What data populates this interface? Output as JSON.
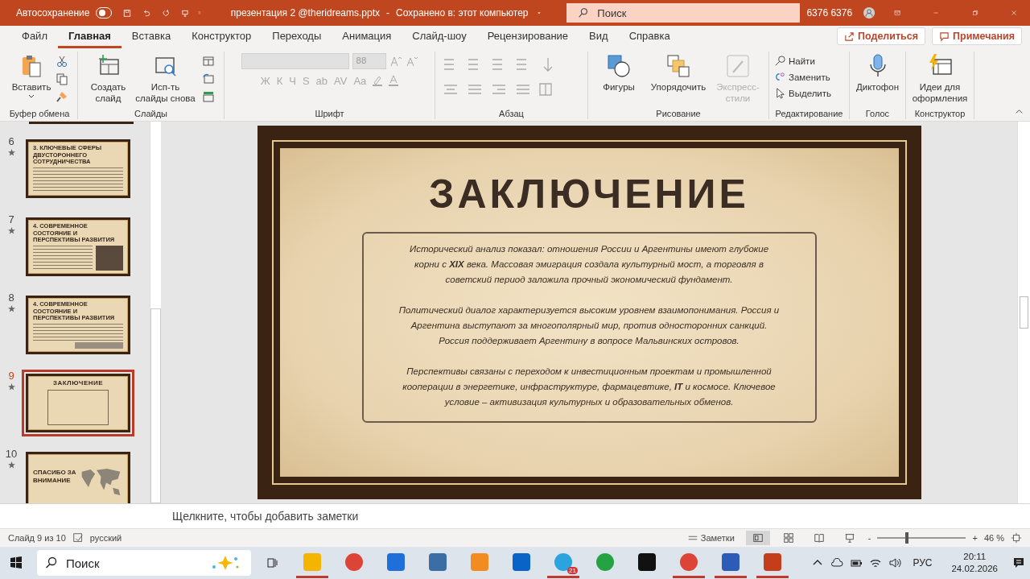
{
  "title_bar": {
    "autosave_label": "Автосохранение",
    "autosave_on": false,
    "document": "презентация 2 @theridreams.pptx",
    "separator": "-",
    "save_status": "Сохранено в: этот компьютер",
    "search_placeholder": "Поиск",
    "user": "6376 6376"
  },
  "tabs": [
    {
      "label": "Файл",
      "selected": false
    },
    {
      "label": "Главная",
      "selected": true
    },
    {
      "label": "Вставка",
      "selected": false
    },
    {
      "label": "Конструктор",
      "selected": false
    },
    {
      "label": "Переходы",
      "selected": false
    },
    {
      "label": "Анимация",
      "selected": false
    },
    {
      "label": "Слайд-шоу",
      "selected": false
    },
    {
      "label": "Рецензирование",
      "selected": false
    },
    {
      "label": "Вид",
      "selected": false
    },
    {
      "label": "Справка",
      "selected": false
    }
  ],
  "share_button": "Поделиться",
  "comments_button": "Примечания",
  "ribbon": {
    "clipboard": {
      "name": "Буфер обмена",
      "paste": "Вставить"
    },
    "slides": {
      "name": "Слайды",
      "new_slide": "Создать слайд",
      "reuse": "Исп-ть слайды снова"
    },
    "font": {
      "name": "Шрифт",
      "size": "88",
      "disabled": true,
      "format_buttons": [
        "Ж",
        "К",
        "Ч",
        "S",
        "ab",
        "AV",
        "Aa"
      ]
    },
    "paragraph": {
      "name": "Абзац"
    },
    "drawing": {
      "name": "Рисование",
      "commands": [
        {
          "label": "Фигуры",
          "kind": "shapes",
          "disabled": false
        },
        {
          "label": "Упорядочить",
          "kind": "arrange",
          "disabled": false
        },
        {
          "label": "Экспресс-стили",
          "kind": "styles",
          "disabled": true
        }
      ]
    },
    "editing": {
      "name": "Редактирование",
      "commands": [
        {
          "label": "Найти",
          "kind": "find"
        },
        {
          "label": "Заменить",
          "kind": "replace"
        },
        {
          "label": "Выделить",
          "kind": "select"
        }
      ]
    },
    "voice": {
      "name": "Голос",
      "command": "Диктофон"
    },
    "designer": {
      "name": "Конструктор",
      "command": "Идеи для оформления"
    }
  },
  "thumbnails": [
    {
      "number": "6",
      "title": "3. КЛЮЧЕВЫЕ СФЕРЫ ДВУСТОРОННЕГО СОТРУДНИЧЕСТВА",
      "kind": "text",
      "selected": false
    },
    {
      "number": "7",
      "title": "4. СОВРЕМЕННОЕ СОСТОЯНИЕ И ПЕРСПЕКТИВЫ РАЗВИТИЯ",
      "kind": "side-photo",
      "selected": false
    },
    {
      "number": "8",
      "title": "4. СОВРЕМЕННОЕ СОСТОЯНИЕ И ПЕРСПЕКТИВЫ РАЗВИТИЯ",
      "kind": "bottom-photo",
      "selected": false
    },
    {
      "number": "9",
      "title": "ЗАКЛЮЧЕНИЕ",
      "kind": "boxed",
      "selected": true
    },
    {
      "number": "10",
      "title": "СПАСИБО ЗА ВНИМАНИЕ",
      "kind": "map",
      "selected": false
    }
  ],
  "slide": {
    "title": "ЗАКЛЮЧЕНИЕ",
    "paragraphs": [
      "Исторический анализ показал: отношения России и Аргентины имеют глубокие корни с **XIX** века. Массовая эмиграция создала культурный мост, а торговля в советский период заложила прочный экономический фундамент.",
      "Политический диалог характеризуется высоким уровнем взаимопонимания. Россия и Аргентина выступают за многополярный мир, против односторонних санкций. Россия поддерживает Аргентину в вопросе Мальвинских островов.",
      "Перспективы связаны с переходом к инвестиционным проектам и промышленной кооперации в энергетике, инфраструктуре, фармацевтике, **IT** и космосе. Ключевое условие  – активизация культурных и образовательных обменов."
    ]
  },
  "notes_placeholder": "Щелкните, чтобы добавить заметки",
  "status_bar": {
    "slide_counter": "Слайд 9 из 10",
    "language": "русский",
    "notes_button": "Заметки",
    "zoom_minus": "-",
    "zoom_plus": "+",
    "zoom": "46 %",
    "level": 0.33
  },
  "taskbar": {
    "search_placeholder": "Поиск",
    "apps": [
      {
        "kind": "folder",
        "running": true
      },
      {
        "kind": "chrome",
        "running": false
      },
      {
        "kind": "store",
        "running": false
      },
      {
        "kind": "python",
        "running": false
      },
      {
        "kind": "sublime",
        "running": false
      },
      {
        "kind": "outlook",
        "running": false
      },
      {
        "kind": "telegram",
        "running": true,
        "badge": "21"
      },
      {
        "kind": "whatsapp",
        "running": false
      },
      {
        "kind": "dark",
        "running": false
      },
      {
        "kind": "chrome",
        "running": true
      },
      {
        "kind": "word",
        "running": true
      },
      {
        "kind": "powerpoint",
        "running": true
      }
    ],
    "language": "РУС",
    "time": "20:11",
    "date": "24.02.2026"
  }
}
